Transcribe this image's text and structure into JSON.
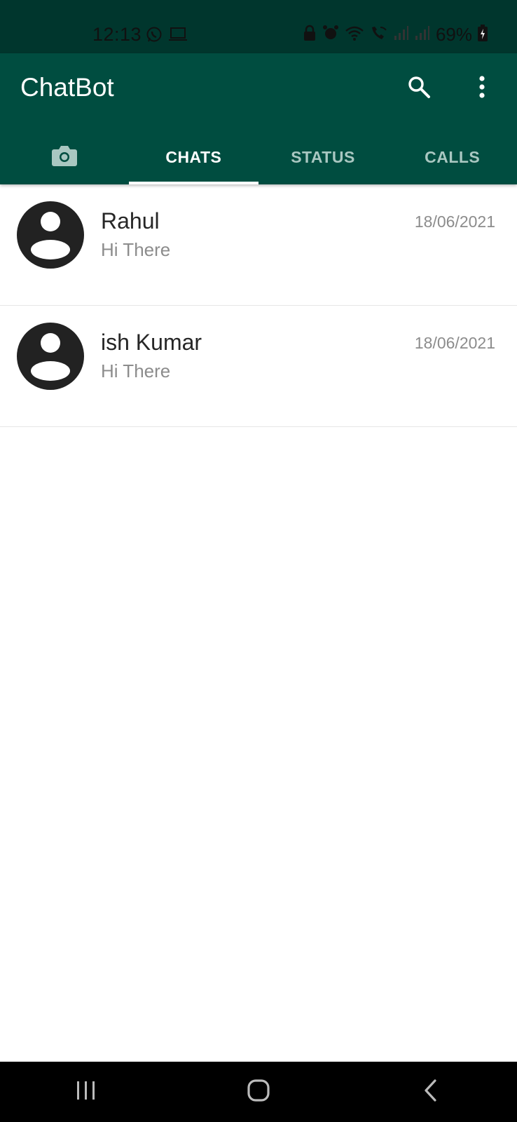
{
  "status_bar": {
    "time": "12:13",
    "battery": "69%",
    "left_icons": [
      "whatsapp-icon",
      "laptop-icon"
    ],
    "right_icons": [
      "lock-icon",
      "alarm-icon",
      "wifi-icon",
      "wifi-calling-icon",
      "signal-icon",
      "signal-icon",
      "battery-icon"
    ]
  },
  "app_bar": {
    "title": "ChatBot",
    "actions": [
      "search-icon",
      "more-vert-icon"
    ]
  },
  "tabs": [
    {
      "label": "",
      "icon": "camera-icon"
    },
    {
      "label": "CHATS",
      "active": true
    },
    {
      "label": "STATUS"
    },
    {
      "label": "CALLS"
    }
  ],
  "chats": [
    {
      "name": "Rahul",
      "preview": "Hi There",
      "date": "18/06/2021"
    },
    {
      "name": "ish Kumar",
      "preview": "Hi There",
      "date": "18/06/2021"
    }
  ],
  "nav_bar": {
    "buttons": [
      "recent-apps-icon",
      "home-icon",
      "back-icon"
    ]
  },
  "colors": {
    "status_bar_bg": "#00362d",
    "app_bar_bg": "#004d40",
    "tab_inactive": "#a9c7c1",
    "tab_active": "#ffffff"
  }
}
